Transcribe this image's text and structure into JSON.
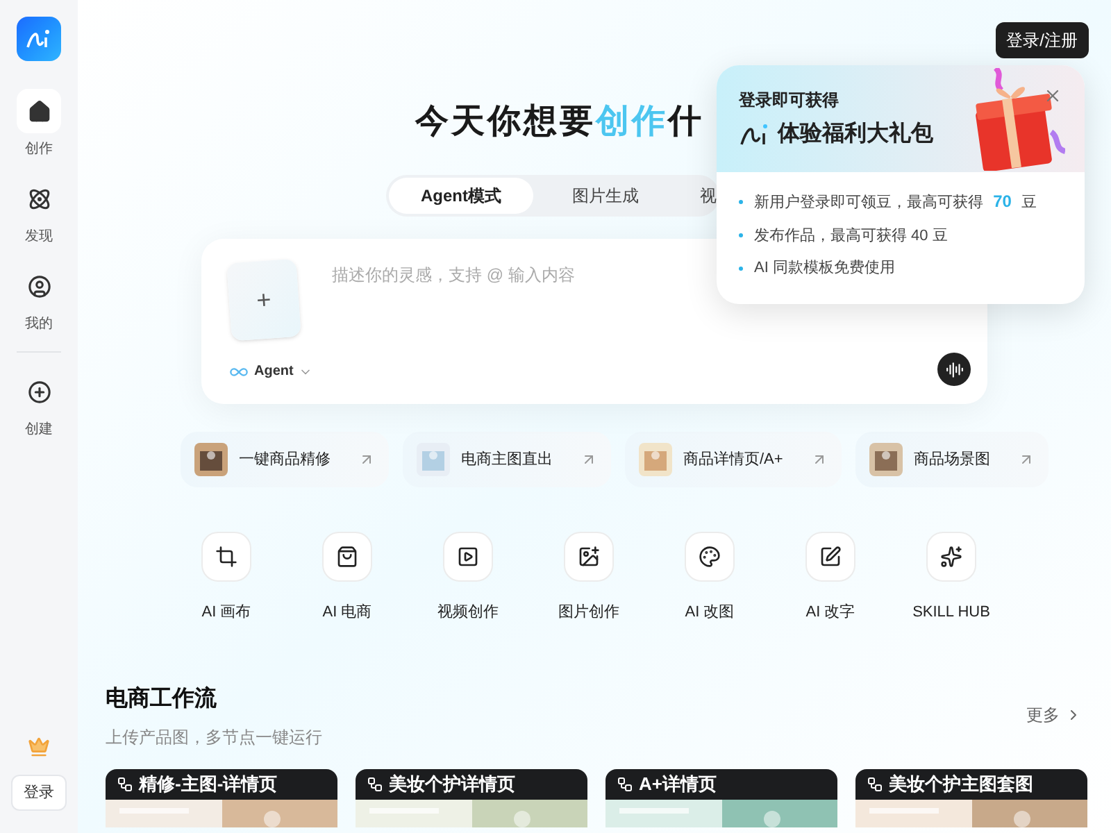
{
  "sidebar": {
    "items": [
      {
        "label": "创作",
        "selected": true
      },
      {
        "label": "发现",
        "selected": false
      },
      {
        "label": "我的",
        "selected": false
      },
      {
        "label": "创建",
        "selected": false
      }
    ],
    "login": "登录"
  },
  "header": {
    "login_button": "登录/注册"
  },
  "hero": {
    "title_before": "今天你想要",
    "title_highlight": "创作",
    "title_after": "什"
  },
  "tabs": [
    {
      "label": "Agent模式",
      "selected": true
    },
    {
      "label": "图片生成",
      "selected": false
    },
    {
      "label": "视",
      "selected": false
    }
  ],
  "prompt": {
    "placeholder": "描述你的灵感，支持 @ 输入内容",
    "add": "+",
    "mode": "Agent"
  },
  "quick_actions": [
    {
      "label": "一键商品精修"
    },
    {
      "label": "电商主图直出"
    },
    {
      "label": "商品详情页/A+"
    },
    {
      "label": "商品场景图"
    }
  ],
  "tools": [
    {
      "label": "AI 画布"
    },
    {
      "label": "AI 电商"
    },
    {
      "label": "视频创作"
    },
    {
      "label": "图片创作"
    },
    {
      "label": "AI 改图"
    },
    {
      "label": "AI 改字"
    },
    {
      "label": "SKILL HUB"
    }
  ],
  "workflow": {
    "title": "电商工作流",
    "subtitle": "上传产品图，多节点一键运行",
    "more": "更多",
    "cards": [
      {
        "title": "精修-主图-详情页"
      },
      {
        "title": "美妆个护详情页"
      },
      {
        "title": "A+详情页"
      },
      {
        "title": "美妆个护主图套图"
      }
    ]
  },
  "popup": {
    "heading": "登录即可获得",
    "title": "体验福利大礼包",
    "bullets": [
      {
        "before": "新用户登录即可领豆，最高可获得",
        "highlight": "70",
        "after": "豆"
      },
      {
        "before": "发布作品，最高可获得 40 豆"
      },
      {
        "before": "AI 同款模板免费使用"
      }
    ]
  }
}
